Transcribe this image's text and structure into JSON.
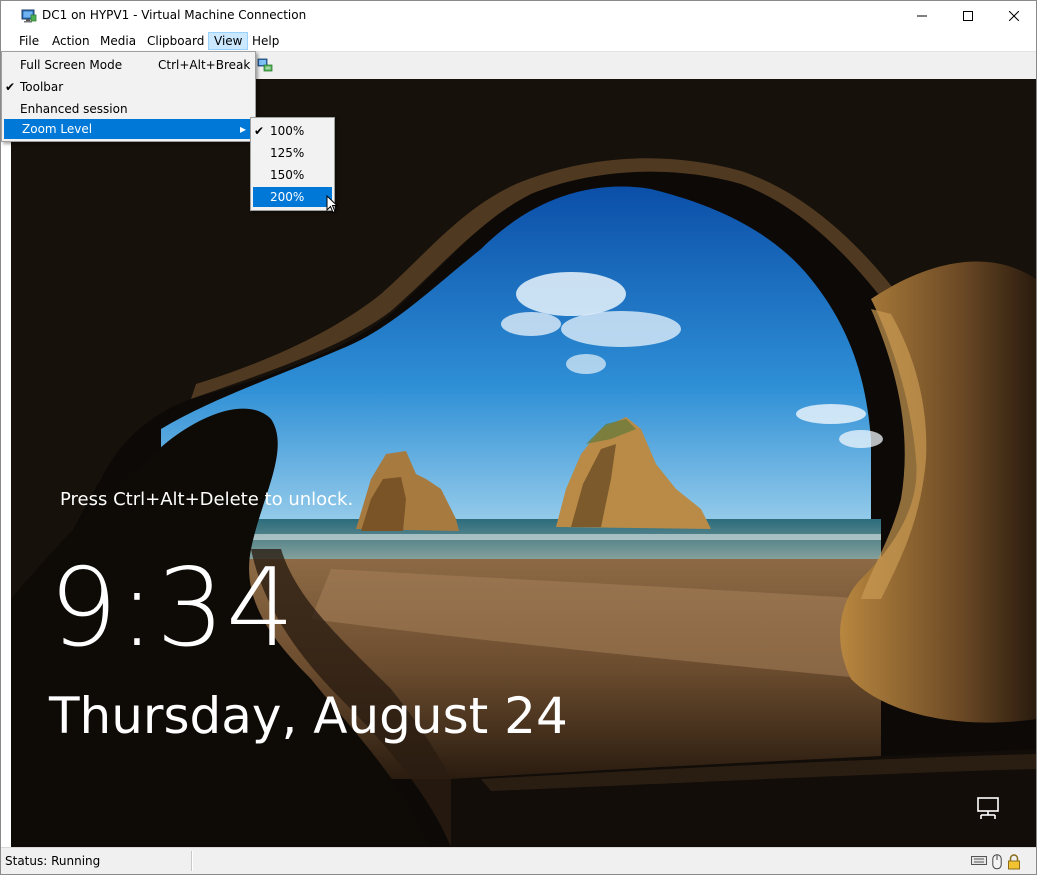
{
  "window": {
    "title": "DC1 on HYPV1 - Virtual Machine Connection"
  },
  "menubar": {
    "file": "File",
    "action": "Action",
    "media": "Media",
    "clipboard": "Clipboard",
    "view": "View",
    "help": "Help"
  },
  "view_menu": {
    "items": [
      {
        "label": "Full Screen Mode",
        "shortcut": "Ctrl+Alt+Break",
        "checked": false
      },
      {
        "label": "Toolbar",
        "checked": true
      },
      {
        "label": "Enhanced session",
        "checked": false
      },
      {
        "label": "Zoom Level",
        "submenu": true,
        "highlighted": true
      }
    ],
    "check_glyph": "✔",
    "arrow_glyph": "▸"
  },
  "zoom_menu": {
    "items": [
      {
        "label": "100%",
        "checked": true
      },
      {
        "label": "125%",
        "checked": false
      },
      {
        "label": "150%",
        "checked": false
      },
      {
        "label": "200%",
        "checked": false,
        "highlighted": true
      }
    ]
  },
  "lockscreen": {
    "hint": "Press Ctrl+Alt+Delete to unlock.",
    "time": "9:34",
    "date": "Thursday, August 24"
  },
  "statusbar": {
    "status": "Status: Running"
  },
  "icons": {
    "app": "vm-monitor-icon",
    "toolbar": "network-adapter-icon",
    "lock_network": "network-icon",
    "keyboard": "keyboard-icon",
    "mouse": "mouse-icon",
    "lock": "padlock-icon"
  },
  "colors": {
    "menu_highlight": "#0078d7",
    "menubar_selected": "#cce8ff"
  }
}
